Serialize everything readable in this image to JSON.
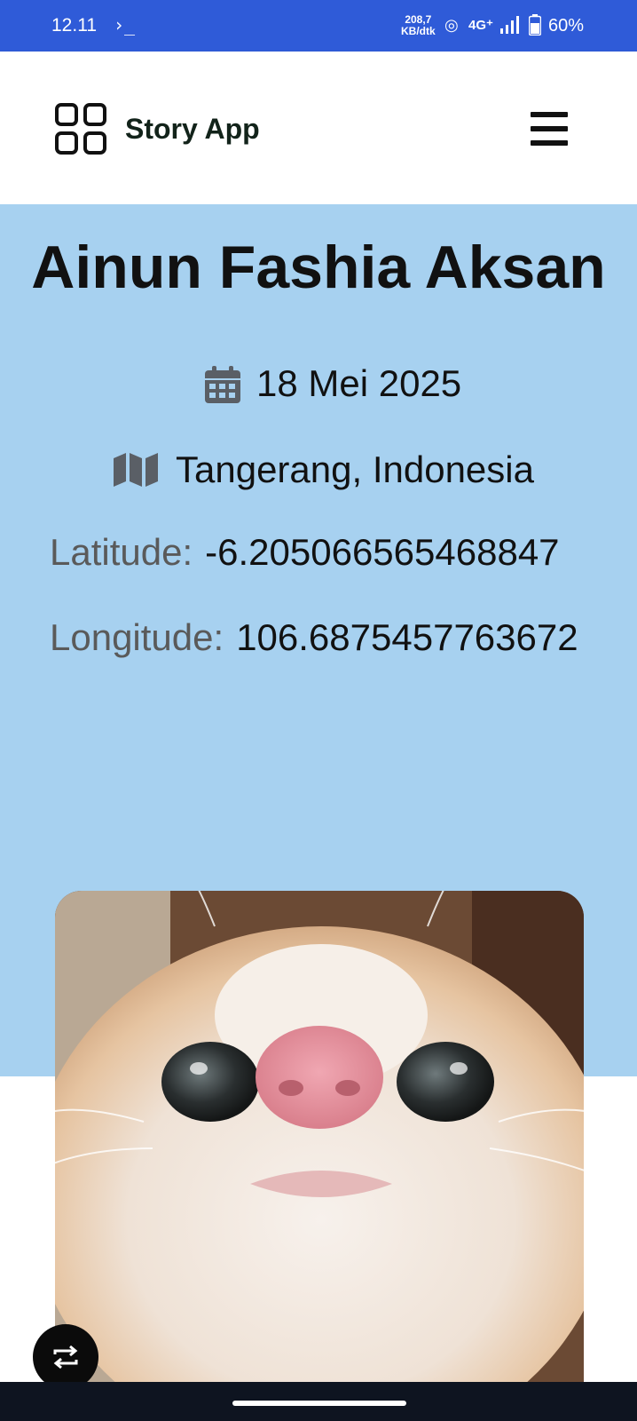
{
  "status_bar": {
    "time": "12.11",
    "terminal_glyph": "›_",
    "speed_value": "208,7",
    "speed_unit": "KB/dtk",
    "network": "4G⁺",
    "battery": "60%"
  },
  "header": {
    "app_name": "Story App",
    "logo_icon": "grid-icon",
    "menu_icon": "hamburger-icon"
  },
  "story": {
    "author_name": "Ainun Fashia Aksan",
    "date": "18 Mei 2025",
    "location": "Tangerang, Indonesia",
    "latitude_label": "Latitude:",
    "latitude_value": "-6.205066565468847",
    "longitude_label": "Longitude:",
    "longitude_value": "106.6875457763672",
    "date_icon": "calendar-icon",
    "location_icon": "map-icon"
  },
  "colors": {
    "status_bar": "#2f5bd8",
    "hero_bg": "#a7d1f0",
    "nav_bar": "#0e1420"
  }
}
